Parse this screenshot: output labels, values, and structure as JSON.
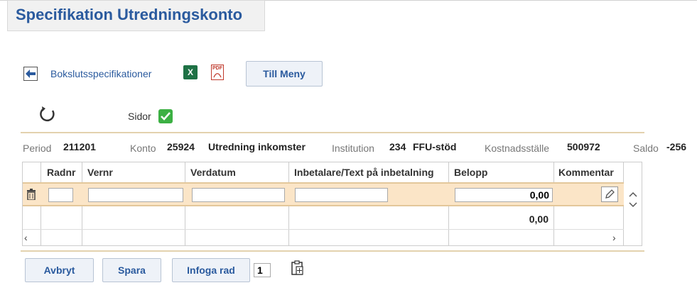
{
  "title": "Specifikation Utredningskonto",
  "nav": {
    "back_link": "Bokslutsspecifikationer",
    "menu_button": "Till Meny",
    "excel_icon": "X",
    "pdf_icon": "PDF"
  },
  "options": {
    "pages_label": "Sidor",
    "pages_checked": true
  },
  "info": {
    "period_label": "Period",
    "period_value": "211201",
    "konto_label": "Konto",
    "konto_value": "25924",
    "konto_name": "Utredning inkomster",
    "institution_label": "Institution",
    "institution_value": "234",
    "institution_name": "FFU-stöd",
    "kostnadsstalle_label": "Kostnadsställe",
    "kostnadsstalle_value": "500972",
    "saldo_label": "Saldo",
    "saldo_value": "-256"
  },
  "table": {
    "columns": [
      "Radnr",
      "Vernr",
      "Verdatum",
      "Inbetalare/Text på inbetalning",
      "Belopp",
      "Kommentar"
    ],
    "row": {
      "radnr": "",
      "vernr": "",
      "verdatum": "",
      "text": "",
      "belopp": "0,00"
    },
    "total": "0,00"
  },
  "actions": {
    "cancel": "Avbryt",
    "save": "Spara",
    "insert_row": "Infoga rad",
    "insert_count": "1"
  }
}
